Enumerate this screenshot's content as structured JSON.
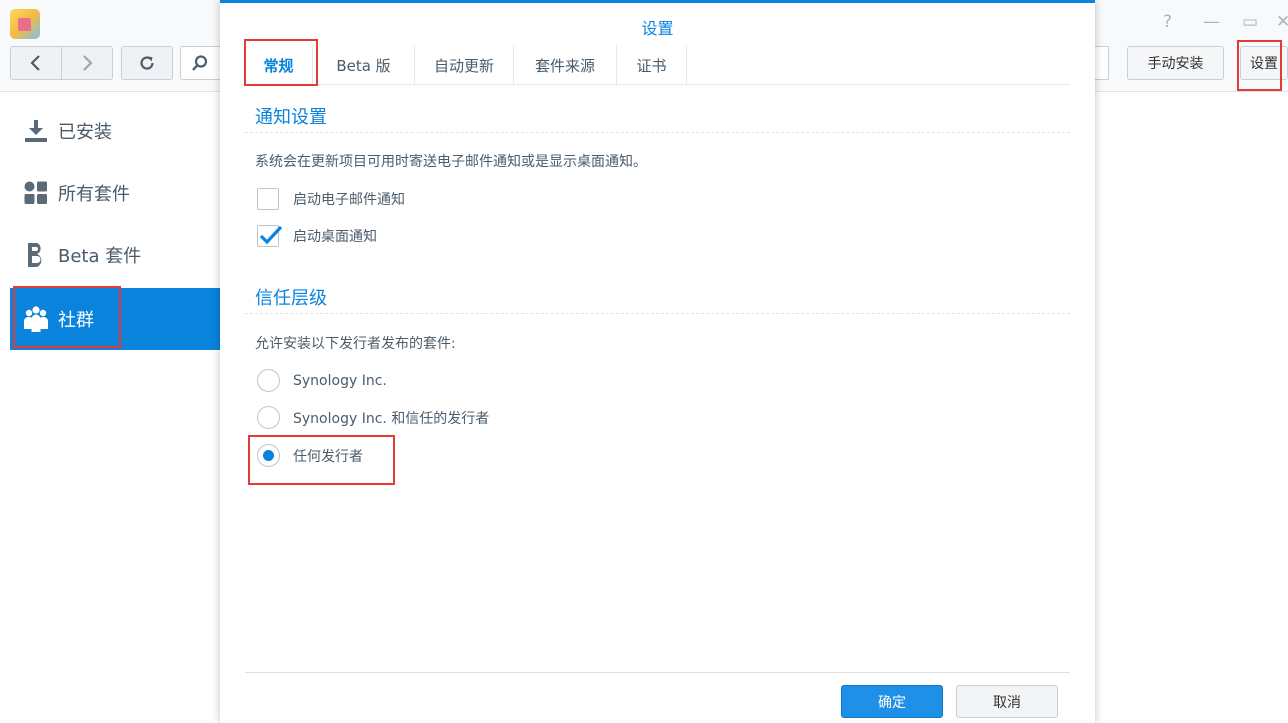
{
  "app": {
    "toolbar": {
      "manual_install_label": "手动安装",
      "settings_label": "设置"
    },
    "sidebar": {
      "items": [
        {
          "label": "已安装",
          "icon": "download-icon"
        },
        {
          "label": "所有套件",
          "icon": "grid-icon"
        },
        {
          "label": "Beta 套件",
          "icon": "beta-icon"
        },
        {
          "label": "社群",
          "icon": "community-icon",
          "active": true
        }
      ]
    }
  },
  "dialog": {
    "title": "设置",
    "tabs": [
      {
        "label": "常规",
        "active": true
      },
      {
        "label": "Beta 版"
      },
      {
        "label": "自动更新"
      },
      {
        "label": "套件来源"
      },
      {
        "label": "证书"
      }
    ],
    "notification": {
      "title": "通知设置",
      "description": "系统会在更新项目可用时寄送电子邮件通知或是显示桌面通知。",
      "email_label": "启动电子邮件通知",
      "email_checked": false,
      "desktop_label": "启动桌面通知",
      "desktop_checked": true
    },
    "trust": {
      "title": "信任层级",
      "description": "允许安装以下发行者发布的套件:",
      "options": [
        {
          "label": "Synology Inc.",
          "selected": false
        },
        {
          "label": "Synology Inc. 和信任的发行者",
          "selected": false
        },
        {
          "label": "任何发行者",
          "selected": true
        }
      ]
    },
    "ok_label": "确定",
    "cancel_label": "取消"
  },
  "colors": {
    "accent": "#0a83dd",
    "highlight": "#e53935"
  }
}
